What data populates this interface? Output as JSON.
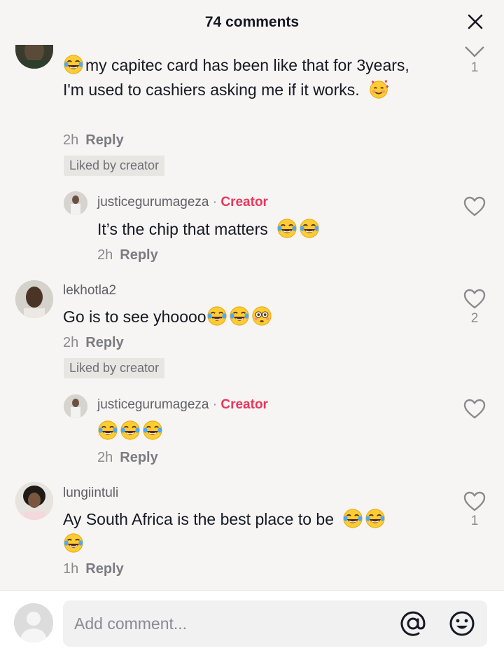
{
  "header": {
    "title": "74 comments"
  },
  "comments": [
    {
      "username": "",
      "text": "my capitec card has been like that for 3years, I'm used to cashiers asking me if it works.",
      "time": "2h",
      "reply_label": "Reply",
      "liked_by_creator": "Liked by creator",
      "like_count": "1",
      "emojis": [
        "face-with-tears-of-joy",
        "smiling-face-with-hearts"
      ]
    },
    {
      "username": "justicegurumageza",
      "creator_label": "Creator",
      "separator": "·",
      "text": "It’s the chip that matters",
      "time": "2h",
      "reply_label": "Reply",
      "emojis": [
        "face-with-tears-of-joy",
        "face-with-tears-of-joy"
      ]
    },
    {
      "username": "lekhotla2",
      "text": "Go is to see yhoooo",
      "time": "2h",
      "reply_label": "Reply",
      "liked_by_creator": "Liked by creator",
      "like_count": "2",
      "emojis": [
        "face-with-tears-of-joy",
        "face-with-tears-of-joy",
        "flushed-face"
      ]
    },
    {
      "username": "justicegurumageza",
      "creator_label": "Creator",
      "separator": "·",
      "text": "",
      "time": "2h",
      "reply_label": "Reply",
      "emojis": [
        "face-with-tears-of-joy",
        "face-with-tears-of-joy",
        "face-with-tears-of-joy"
      ]
    },
    {
      "username": "lungiintuli",
      "text": "Ay South Africa is the best place to be",
      "time": "1h",
      "reply_label": "Reply",
      "like_count": "1",
      "emojis": [
        "face-with-tears-of-joy",
        "face-with-tears-of-joy",
        "face-with-tears-of-joy"
      ]
    }
  ],
  "footer": {
    "placeholder": "Add comment..."
  },
  "colors": {
    "background": "#f6f5f3",
    "creator_accent": "#e8375c",
    "muted_text": "#8a8a8f"
  }
}
